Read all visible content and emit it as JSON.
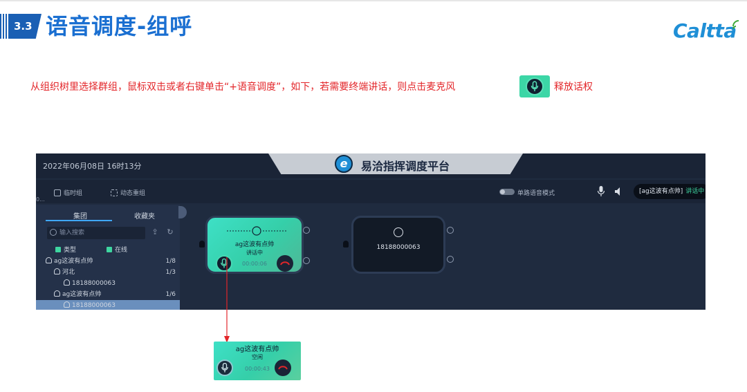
{
  "slide": {
    "section_number": "3.3",
    "title": "语音调度-组呼",
    "brand": "Caltta",
    "instruction_text": "从组织树里选择群组，鼠标双击或者右键单击“+语音调度”，如下，若需要终端讲话，则点击麦克风",
    "instruction_tail": "释放话权"
  },
  "app": {
    "datetime": "2022年06月08日 16时13分",
    "platform_title": "易洽指挥调度平台",
    "logo_letter": "e",
    "toolbar": {
      "temp_group": "临时组",
      "dynamic_regroup": "动态重组",
      "single_voice_mode": "单路语音模式",
      "speaking_group": "[ag这波有点帅]",
      "speaking_status": "讲话中",
      "left_ellipsis": "0..."
    },
    "sidebar": {
      "tabs": [
        "集团",
        "收藏夹"
      ],
      "search_placeholder": "输入搜索",
      "filters": [
        "类型",
        "在线"
      ],
      "tree": [
        {
          "label": "ag这波有点帅",
          "count": "1/8",
          "level": 0
        },
        {
          "label": "河北",
          "count": "1/3",
          "level": 1
        },
        {
          "label": "18188000063",
          "count": "",
          "level": 2
        },
        {
          "label": "ag这波有点帅",
          "count": "1/6",
          "level": 1
        },
        {
          "label": "18188000063",
          "count": "",
          "level": 2,
          "selected": true
        }
      ]
    },
    "cards": {
      "active": {
        "name": "ag这波有点帅",
        "status": "讲话中",
        "time": "00:00:06"
      },
      "idle": {
        "name": "18188000063"
      }
    }
  },
  "popup": {
    "name": "ag这波有点帅",
    "status": "空闲",
    "time": "00:00:43"
  },
  "colors": {
    "title_blue": "#1a6fd1",
    "instruction_red": "#e3262a",
    "card_green": "#35cfa9",
    "app_bg": "#1f2b3f",
    "arrow_red": "#e3262a"
  },
  "icons": [
    "microphone-icon",
    "hangup-icon",
    "group-avatar-icon",
    "user-icon",
    "speaker-icon",
    "search-icon",
    "refresh-icon",
    "share-icon",
    "gear-icon"
  ]
}
